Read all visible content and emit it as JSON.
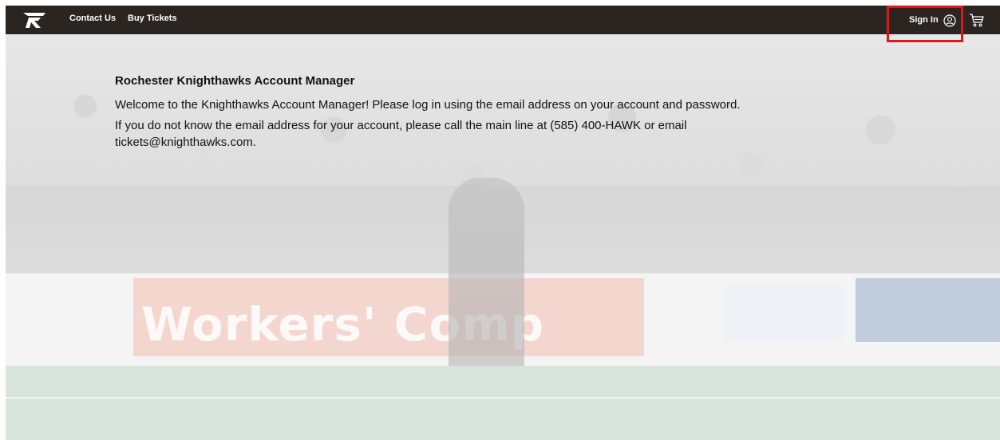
{
  "nav": {
    "logo_icon": "knighthawks-logo-icon",
    "contact_label": "Contact Us",
    "buy_tickets_label": "Buy Tickets",
    "sign_in_label": "Sign In",
    "sign_in_icon": "user-circle-icon",
    "cart_icon": "cart-icon"
  },
  "hero": {
    "ad_text": "Workers' Comp"
  },
  "content": {
    "title": "Rochester Knighthawks Account Manager",
    "welcome": "Welcome to the Knighthawks Account Manager! Please log in using the email address on your account and password.",
    "help_line_1": "If you do not know the email address for your account, please call the main line at (585) 400-HAWK or email",
    "help_line_2": "tickets@knighthawks.com."
  },
  "colors": {
    "topbar": "#2b2522",
    "highlight_border": "#e0141a",
    "text": "#121212"
  }
}
